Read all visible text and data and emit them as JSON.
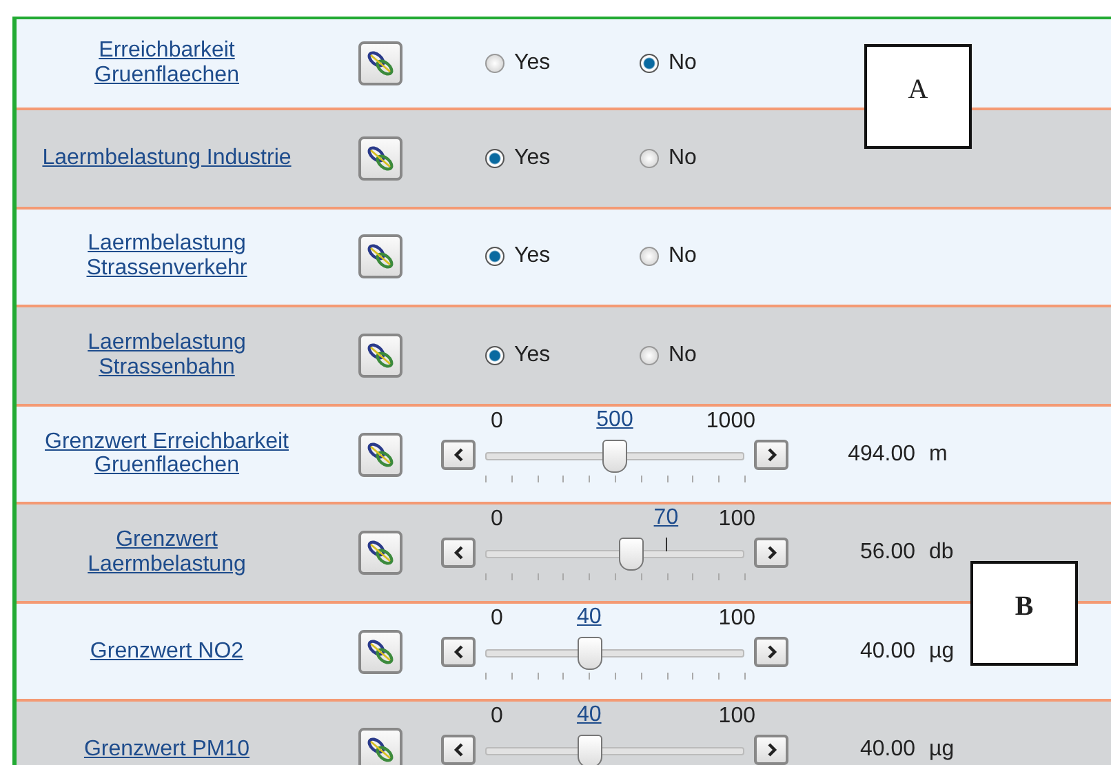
{
  "rows": [
    {
      "kind": "radio",
      "label": "Erreichbarkeit Gruenflaechen",
      "options": [
        {
          "label": "Yes",
          "selected": false
        },
        {
          "label": "No",
          "selected": true
        }
      ]
    },
    {
      "kind": "radio",
      "label": "Laermbelastung Industrie",
      "options": [
        {
          "label": "Yes",
          "selected": true
        },
        {
          "label": "No",
          "selected": false
        }
      ]
    },
    {
      "kind": "radio",
      "label": "Laermbelastung Strassenverkehr",
      "options": [
        {
          "label": "Yes",
          "selected": true
        },
        {
          "label": "No",
          "selected": false
        }
      ]
    },
    {
      "kind": "radio",
      "label": "Laermbelastung Strassenbahn",
      "options": [
        {
          "label": "Yes",
          "selected": true
        },
        {
          "label": "No",
          "selected": false
        }
      ]
    },
    {
      "kind": "slider",
      "label": "Grenzwert Erreichbarkeit Gruenflaechen",
      "min": "0",
      "max": "1000",
      "marker": {
        "label": "500",
        "level": 0.5
      },
      "level": 0.494,
      "value": "494.00",
      "unit": "m"
    },
    {
      "kind": "slider",
      "label": "Grenzwert Laermbelastung",
      "min": "0",
      "max": "100",
      "marker": {
        "label": "70",
        "level": 0.7
      },
      "level": 0.56,
      "value": "56.00",
      "unit": "db"
    },
    {
      "kind": "slider",
      "label": "Grenzwert NO2",
      "min": "0",
      "max": "100",
      "marker": {
        "label": "40",
        "level": 0.4
      },
      "level": 0.4,
      "value": "40.00",
      "unit": "µg"
    },
    {
      "kind": "slider",
      "label": "Grenzwert PM10",
      "min": "0",
      "max": "100",
      "marker": {
        "label": "40",
        "level": 0.4
      },
      "level": 0.4,
      "value": "40.00",
      "unit": "µg"
    }
  ],
  "annotations": [
    {
      "label": "A"
    },
    {
      "label": "B"
    }
  ]
}
